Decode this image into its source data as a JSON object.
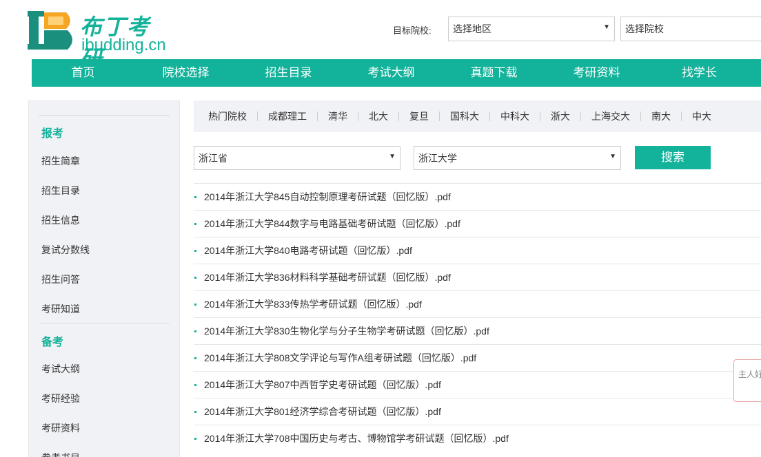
{
  "header": {
    "logo_cn": "布丁考研",
    "logo_en": "ibudding.cn",
    "target_label": "目标院校:",
    "region_select": "选择地区",
    "school_input": "选择院校"
  },
  "nav": [
    "首页",
    "院校选择",
    "招生目录",
    "考试大纲",
    "真题下载",
    "考研资料",
    "找学长"
  ],
  "sidebar": {
    "section1": "报考",
    "items1": [
      "招生简章",
      "招生目录",
      "招生信息",
      "复试分数线",
      "招生问答",
      "考研知道"
    ],
    "section2": "备考",
    "items2": [
      "考试大纲",
      "考研经验",
      "考研资料",
      "参考书目"
    ]
  },
  "hot": [
    "热门院校",
    "成都理工",
    "清华",
    "北大",
    "复旦",
    "国科大",
    "中科大",
    "浙大",
    "上海交大",
    "南大",
    "中大"
  ],
  "filter": {
    "province": "浙江省",
    "university": "浙江大学",
    "search_label": "搜索"
  },
  "files": [
    "2014年浙江大学845自动控制原理考研试题（回忆版）.pdf",
    "2014年浙江大学844数字与电路基础考研试题（回忆版）.pdf",
    "2014年浙江大学840电路考研试题（回忆版）.pdf",
    "2014年浙江大学836材料科学基础考研试题（回忆版）.pdf",
    "2014年浙江大学833传热学考研试题（回忆版）.pdf",
    "2014年浙江大学830生物化学与分子生物学考研试题（回忆版）.pdf",
    "2014年浙江大学808文学评论与写作A组考研试题（回忆版）.pdf",
    "2014年浙江大学807中西哲学史考研试题（回忆版）.pdf",
    "2014年浙江大学801经济学综合考研试题（回忆版）.pdf",
    "2014年浙江大学708中国历史与考古、博物馆学考研试题（回忆版）.pdf"
  ],
  "chat": {
    "text": "主人好"
  },
  "colors": {
    "accent": "#13b29a",
    "logo_dark": "#1a8f7e",
    "logo_orange": "#f5a623"
  },
  "icons": {
    "dropdown": "triangle-down"
  }
}
